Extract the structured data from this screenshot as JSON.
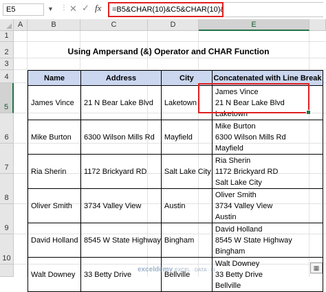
{
  "formula_bar": {
    "name_box": "E5",
    "fx_label": "fx",
    "formula": "=B5&CHAR(10)&C5&CHAR(10)&D5"
  },
  "columns": [
    "A",
    "B",
    "C",
    "D",
    "E"
  ],
  "selected_column": "E",
  "rows": [
    "1",
    "2",
    "3",
    "4",
    "5",
    "6",
    "7",
    "8",
    "9",
    "10"
  ],
  "selected_row": "5",
  "title": "Using Ampersand (&) Operator and CHAR Function",
  "table": {
    "headers": [
      "Name",
      "Address",
      "City",
      "Concatenated with Line Break"
    ],
    "rows": [
      {
        "name": "James Vince",
        "address": "21 N Bear Lake Blvd",
        "city": "Laketown",
        "concat": [
          "James Vince",
          "21 N Bear Lake Blvd",
          "Laketown"
        ]
      },
      {
        "name": "Mike Burton",
        "address": "6300 Wilson Mills Rd",
        "city": "Mayfield",
        "concat": [
          "Mike Burton",
          "6300 Wilson Mills Rd",
          "Mayfield"
        ]
      },
      {
        "name": "Ria Sherin",
        "address": "1172 Brickyard RD",
        "city": "Salt Lake City",
        "concat": [
          "Ria Sherin",
          "1172 Brickyard RD",
          "Salt Lake City"
        ]
      },
      {
        "name": "Oliver Smith",
        "address": "3734 Valley View",
        "city": "Austin",
        "concat": [
          "Oliver Smith",
          "3734 Valley View",
          "Austin"
        ]
      },
      {
        "name": "David Holland",
        "address": "8545 W State Highway",
        "city": "Bingham",
        "concat": [
          "David Holland",
          "8545 W State Highway",
          "Bingham"
        ]
      },
      {
        "name": "Walt Downey",
        "address": "33 Betty Drive",
        "city": "Bellville",
        "concat": [
          "Walt Downey",
          "33 Betty Drive",
          "Bellville"
        ]
      }
    ]
  },
  "watermark": {
    "brand": "exceldemy",
    "tagline": "EXCEL · DATA · BI"
  },
  "icons": {
    "name_box_dropdown": "chevron-down-icon",
    "cancel": "close-icon",
    "enter": "check-icon",
    "function": "fx-icon",
    "quick_analysis": "quick-analysis-icon"
  },
  "colors": {
    "header_fill": "#cbd7ef",
    "highlight": "#e02020",
    "excel_green": "#217346"
  }
}
